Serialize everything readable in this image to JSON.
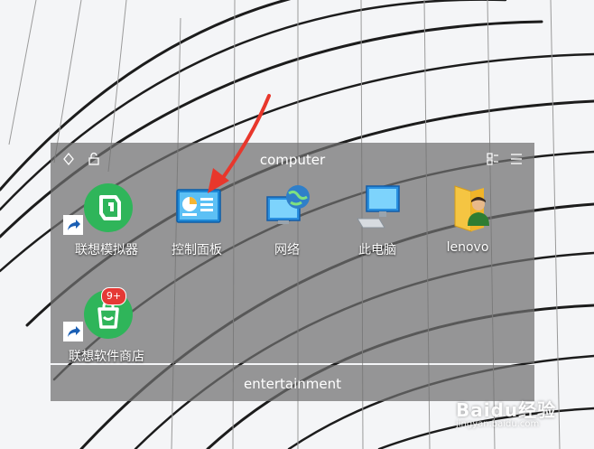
{
  "fences": [
    {
      "title": "computer",
      "icons": [
        {
          "label": "联想模拟器",
          "icon": "lenovo-emulator-icon",
          "shortcut": true
        },
        {
          "label": "控制面板",
          "icon": "control-panel-icon",
          "shortcut": false
        },
        {
          "label": "网络",
          "icon": "network-icon",
          "shortcut": false
        },
        {
          "label": "此电脑",
          "icon": "this-pc-icon",
          "shortcut": false
        },
        {
          "label": "lenovo",
          "icon": "user-folder-icon",
          "shortcut": false
        },
        {
          "label": "联想软件商店",
          "icon": "lenovo-app-store-icon",
          "shortcut": true,
          "badge": "9+"
        }
      ]
    },
    {
      "title": "entertainment",
      "icons": []
    }
  ],
  "watermark": {
    "brand": "Baidu经验",
    "url": "jingyan.baidu.com"
  },
  "colors": {
    "fence_bg": "#707070",
    "arrow": "#e8372c",
    "emulator_green": "#2fb55a",
    "badge_red": "#e53935"
  }
}
